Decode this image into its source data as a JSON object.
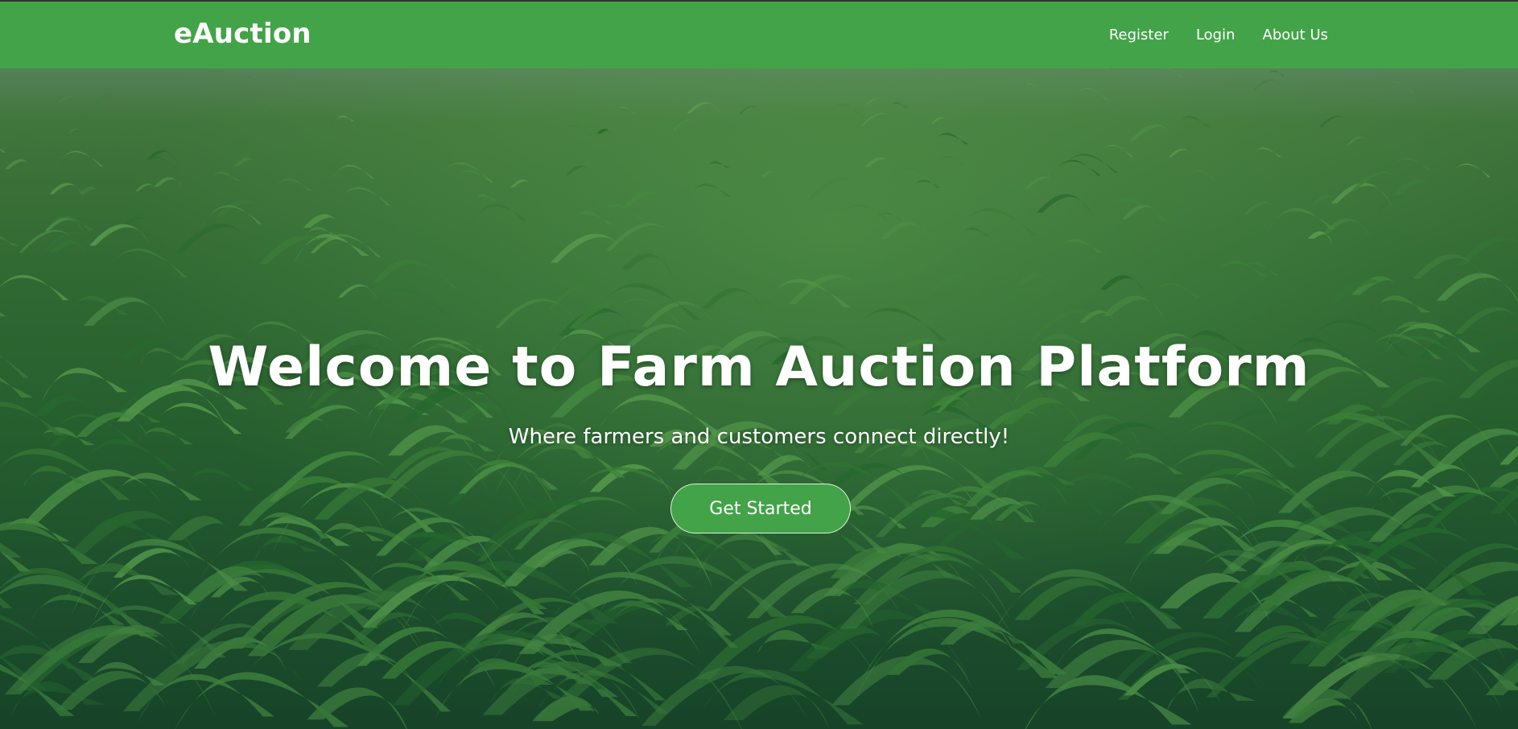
{
  "navbar": {
    "brand": "eAuction",
    "links": [
      "Register",
      "Login",
      "About Us"
    ]
  },
  "hero": {
    "title": "Welcome to Farm Auction Platform",
    "subtitle": "Where farmers and customers connect directly!",
    "cta_label": "Get Started",
    "background_image": "corn-field-photo"
  },
  "colors": {
    "navbar_bg": "#43a348",
    "button_bg": "#43a348",
    "text": "#ffffff"
  }
}
